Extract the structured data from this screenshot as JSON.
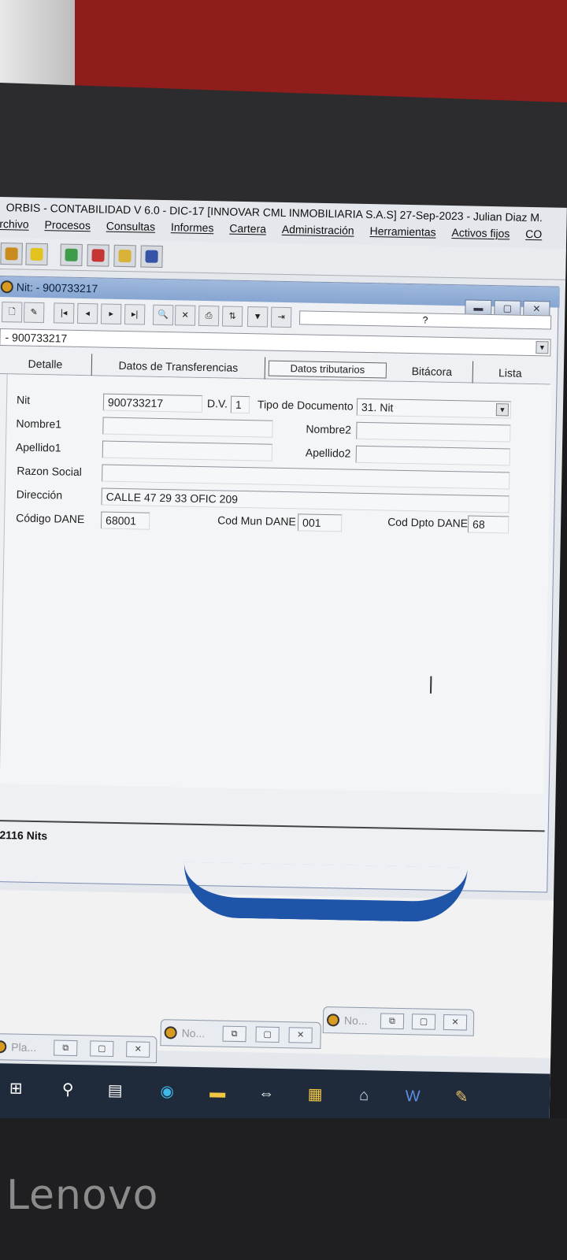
{
  "app": {
    "title": "ORBIS - CONTABILIDAD V 6.0 - DIC-17 [INNOVAR CML INMOBILIARIA S.A.S] 27-Sep-2023 - Julian Diaz M.",
    "menu": [
      "rchivo",
      "Procesos",
      "Consultas",
      "Informes",
      "Cartera",
      "Administración",
      "Herramientas",
      "Activos fijos",
      "CO"
    ]
  },
  "window": {
    "title": "Nit:  - 900733217",
    "record_combo": "- 900733217",
    "help_label": "?",
    "tabs": [
      "Detalle",
      "Datos de Transferencias",
      "Datos tributarios",
      "Bitácora",
      "Lista"
    ],
    "active_tab": "Datos tributarios"
  },
  "form": {
    "nit_label": "Nit",
    "nit_value": "900733217",
    "dv_label": "D.V.",
    "dv_value": "1",
    "tipo_doc_label": "Tipo de Documento",
    "tipo_doc_value": "31. Nit",
    "nombre1_label": "Nombre1",
    "nombre1_value": "",
    "nombre2_label": "Nombre2",
    "nombre2_value": "",
    "apellido1_label": "Apellido1",
    "apellido1_value": "",
    "apellido2_label": "Apellido2",
    "apellido2_value": "",
    "razon_social_label": "Razon Social",
    "razon_social_value": "",
    "direccion_label": "Dirección",
    "direccion_value": "CALLE 47  29 33 OFIC 209",
    "codigo_dane_label": "Código DANE",
    "codigo_dane_value": "68001",
    "cod_mun_label": "Cod Mun DANE",
    "cod_mun_value": "001",
    "cod_dpto_label": "Cod Dpto DANE",
    "cod_dpto_value": "68"
  },
  "status": {
    "count": "2116 Nits"
  },
  "minimized": [
    {
      "label": "Pla..."
    },
    {
      "label": "No..."
    },
    {
      "label": "No..."
    }
  ],
  "monitor_brand": "Lenovo"
}
